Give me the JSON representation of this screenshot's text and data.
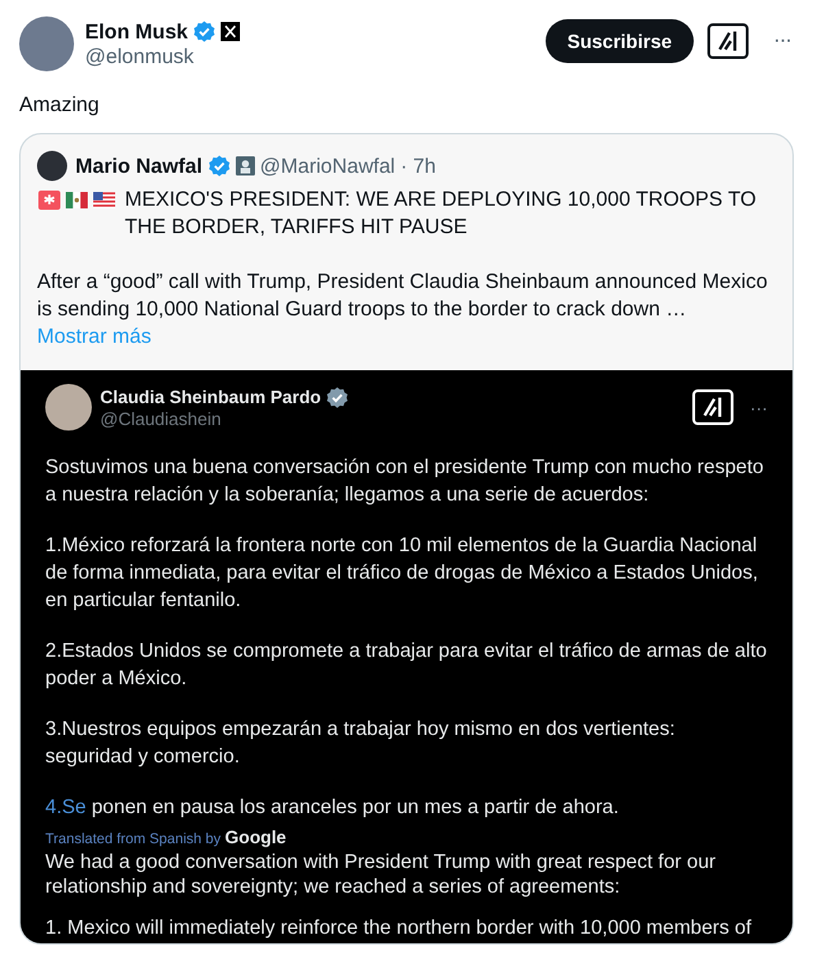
{
  "post": {
    "author": {
      "name": "Elon Musk",
      "handle": "@elonmusk",
      "color": "#1d9bf0",
      "affiliate": true
    },
    "subscribe_button": "Suscribirse",
    "more": "···",
    "text": "Amazing",
    "quote": {
      "author": {
        "name": "Mario Nawfal",
        "handle": "@MarioNawfal",
        "color": "#1d9bf0",
        "affiliate": true
      },
      "time": "· 7h",
      "headline": "MEXICO'S PRESIDENT: WE ARE DEPLOYING 10,000 TROOPS TO THE BORDER, TARIFFS HIT PAUSE",
      "body": "After a “good” call with Trump, President Claudia Sheinbaum announced Mexico is sending 10,000 National Guard troops to the border to crack down …",
      "show_more": "Mostrar más",
      "image": {
        "author": {
          "name": "Claudia Sheinbaum Pardo",
          "handle": "@Claudiashein",
          "color": "#829aab",
          "affiliate": false
        },
        "more": "···",
        "paragraphs": [
          {
            "text": "Sostuvimos una buena conversación con el presidente Trump con mucho respeto a nuestra relación y la soberanía; llegamos a una serie de acuerdos:"
          },
          {
            "text": "1.México reforzará la frontera norte con 10 mil elementos de la Guardia Nacional de forma inmediata, para evitar el tráfico de drogas de México a Estados Unidos, en particular fentanilo."
          },
          {
            "text": "2.Estados Unidos se compromete a trabajar para evitar el tráfico de armas de alto poder a México."
          },
          {
            "text": "3.Nuestros equipos empezarán a trabajar hoy mismo en dos vertientes: seguridad y comercio."
          },
          {
            "link": "4.Se",
            "text": " ponen en pausa los aranceles por un mes a partir de ahora."
          }
        ],
        "translated_by": "Translated from Spanish by",
        "translator": "Google",
        "translation": [
          "We had a good conversation with President Trump with great respect for our relationship and sovereignty; we reached a series of agreements:",
          "1. Mexico will immediately reinforce the northern border with 10,000 members of"
        ]
      }
    }
  }
}
